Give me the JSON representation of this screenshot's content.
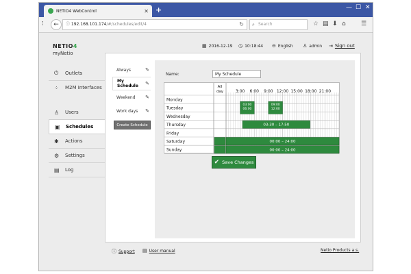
{
  "browser": {
    "tab_title": "NETIO4 WebControl",
    "url_host": "192.168.101.174",
    "url_path": "/#/schedules/edit/4",
    "search_placeholder": "Search"
  },
  "header": {
    "brand_main": "NETIO",
    "brand_suffix": "4",
    "device_name": "myNetio",
    "date": "2016-12-19",
    "time": "10:18:44",
    "language": "English",
    "user": "admin",
    "sign_out": "Sign out"
  },
  "sidebar": {
    "items": [
      {
        "label": "Outlets",
        "icon": "power-icon"
      },
      {
        "label": "M2M Interfaces",
        "icon": "m2m-icon"
      },
      {
        "label": "Users",
        "icon": "user-icon"
      },
      {
        "label": "Schedules",
        "icon": "calendar-icon"
      },
      {
        "label": "Actions",
        "icon": "actions-icon"
      },
      {
        "label": "Settings",
        "icon": "gear-icon"
      },
      {
        "label": "Log",
        "icon": "log-icon"
      }
    ]
  },
  "schedules": {
    "items": [
      "Always",
      "My Schedule",
      "Weekend",
      "Work days"
    ],
    "active": "My Schedule",
    "create_label": "Create Schedule"
  },
  "editor": {
    "name_label": "Name:",
    "name_value": "My Schedule",
    "allday_label": [
      "All",
      "day"
    ],
    "hour_labels": [
      "3:00",
      "6:00",
      "9:00",
      "12:00",
      "15:00",
      "18:00",
      "21:00"
    ],
    "days": [
      "Monday",
      "Tuesday",
      "Wednesday",
      "Thursday",
      "Friday",
      "Saturday",
      "Sunday"
    ],
    "blocks": [
      {
        "day": 1,
        "start": 3,
        "end": 6,
        "label": "03:00\n06:00"
      },
      {
        "day": 1,
        "start": 9,
        "end": 12,
        "label": "09:00\n12:00"
      },
      {
        "day": 3,
        "start": 3.5,
        "end": 17.83,
        "label": "03:30 – 17:50"
      },
      {
        "day": 5,
        "start": 0,
        "end": 24,
        "label": "00:00 – 24:00"
      },
      {
        "day": 6,
        "start": 0,
        "end": 24,
        "label": "00:00 – 24:00"
      }
    ],
    "allday_days": [
      5,
      6
    ],
    "save_label": "Save Changes",
    "colors": {
      "block": "#2e8a3e",
      "block_border": "#1e5e29",
      "grid_line": "#c8c8c8"
    }
  },
  "footer": {
    "support": "Support",
    "manual": "User manual",
    "company": "Netio Products a.s."
  }
}
